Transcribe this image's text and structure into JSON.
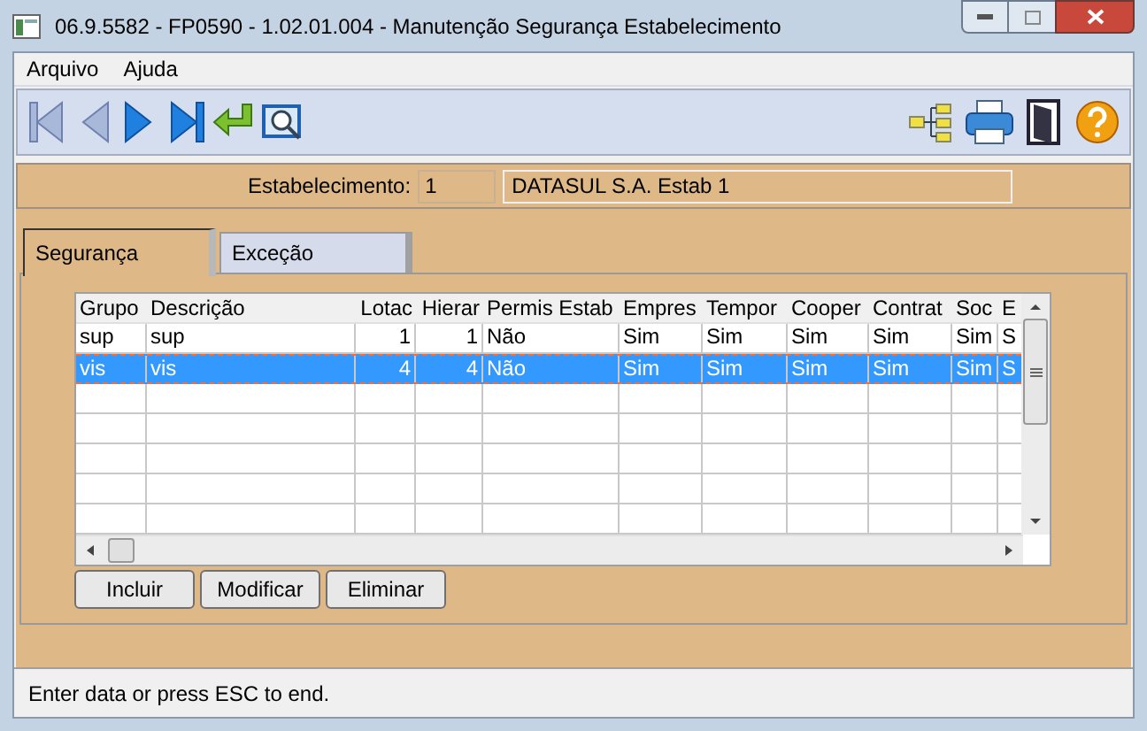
{
  "window": {
    "title": "06.9.5582 - FP0590 - 1.02.01.004 - Manutenção Segurança Estabelecimento"
  },
  "menu": [
    {
      "label": "Arquivo"
    },
    {
      "label": "Ajuda"
    }
  ],
  "establishment": {
    "label": "Estabelecimento:",
    "code": "1",
    "name": "DATASUL S.A. Estab 1"
  },
  "tabs": [
    {
      "label": "Segurança",
      "selected": true
    },
    {
      "label": "Exceção",
      "selected": false
    }
  ],
  "table": {
    "columns": [
      "Grupo",
      "Descrição",
      "Lotac",
      "Hierar",
      "Permis Estab",
      "Empres",
      "Tempor",
      "Cooper",
      "Contrat",
      "Soc",
      "E"
    ],
    "rows": [
      {
        "cells": [
          "sup",
          "sup",
          "1",
          "1",
          "Não",
          "Sim",
          "Sim",
          "Sim",
          "Sim",
          "Sim",
          "S"
        ],
        "selected": false
      },
      {
        "cells": [
          "vis",
          "vis",
          "4",
          "4",
          "Não",
          "Sim",
          "Sim",
          "Sim",
          "Sim",
          "Sim",
          "S"
        ],
        "selected": true
      }
    ]
  },
  "buttons": [
    "Incluir",
    "Modificar",
    "Eliminar"
  ],
  "status_bar": "Enter data or press ESC to end."
}
